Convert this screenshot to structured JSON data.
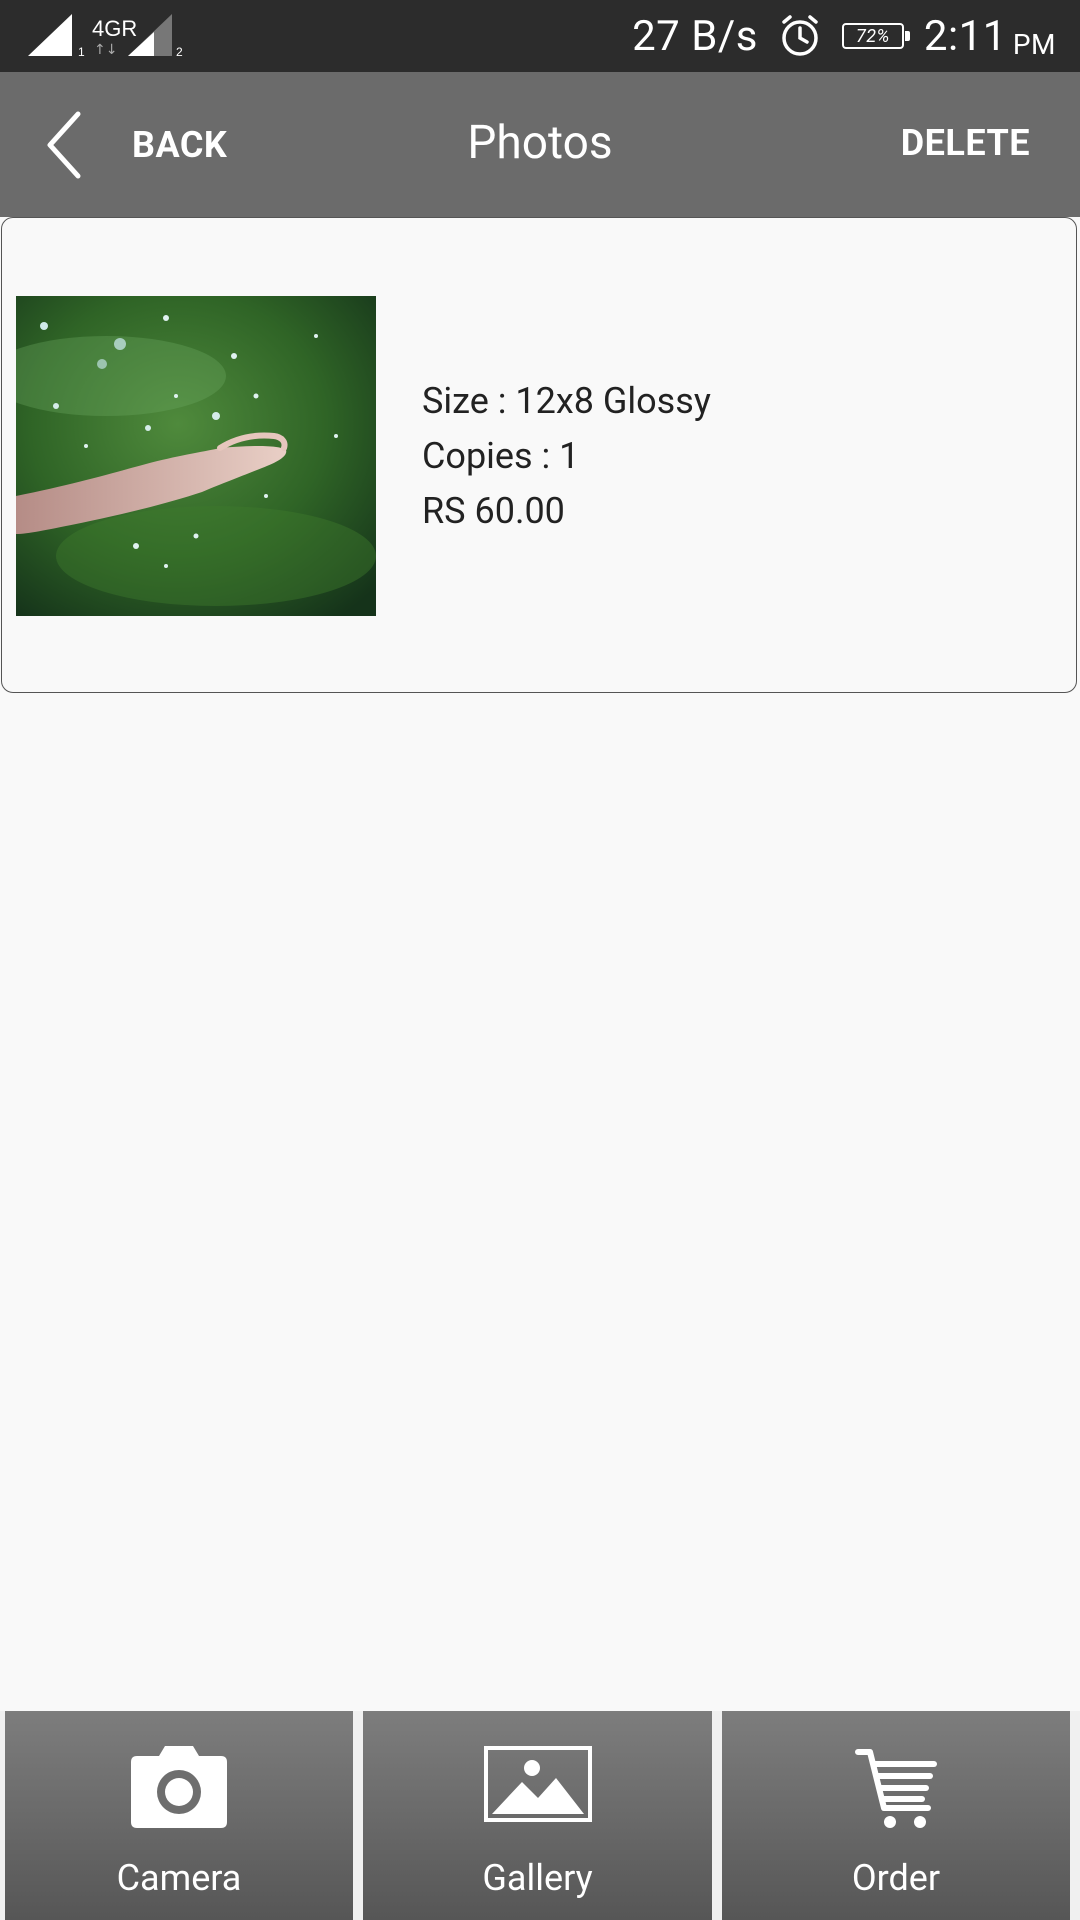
{
  "status_bar": {
    "network_label": "4GR",
    "sim1_label": "1",
    "sim2_label": "2",
    "data_rate": "27 B/s",
    "battery_percent": "72%",
    "time": "2:11",
    "ampm": "PM"
  },
  "header": {
    "back_label": "BACK",
    "title": "Photos",
    "delete_label": "DELETE"
  },
  "photo_item": {
    "size": "Size : 12x8 Glossy",
    "copies": "Copies : 1",
    "price": "RS 60.00"
  },
  "bottom_nav": {
    "camera_label": "Camera",
    "gallery_label": "Gallery",
    "order_label": "Order"
  },
  "icons": {
    "back": "chevron-left-icon",
    "camera": "camera-icon",
    "gallery": "image-icon",
    "order": "cart-icon",
    "alarm": "alarm-clock-icon",
    "battery": "battery-icon"
  },
  "colors": {
    "status_bar": "#2c2c2c",
    "app_bar": "#6b6b6b",
    "background": "#f9f9f9"
  }
}
